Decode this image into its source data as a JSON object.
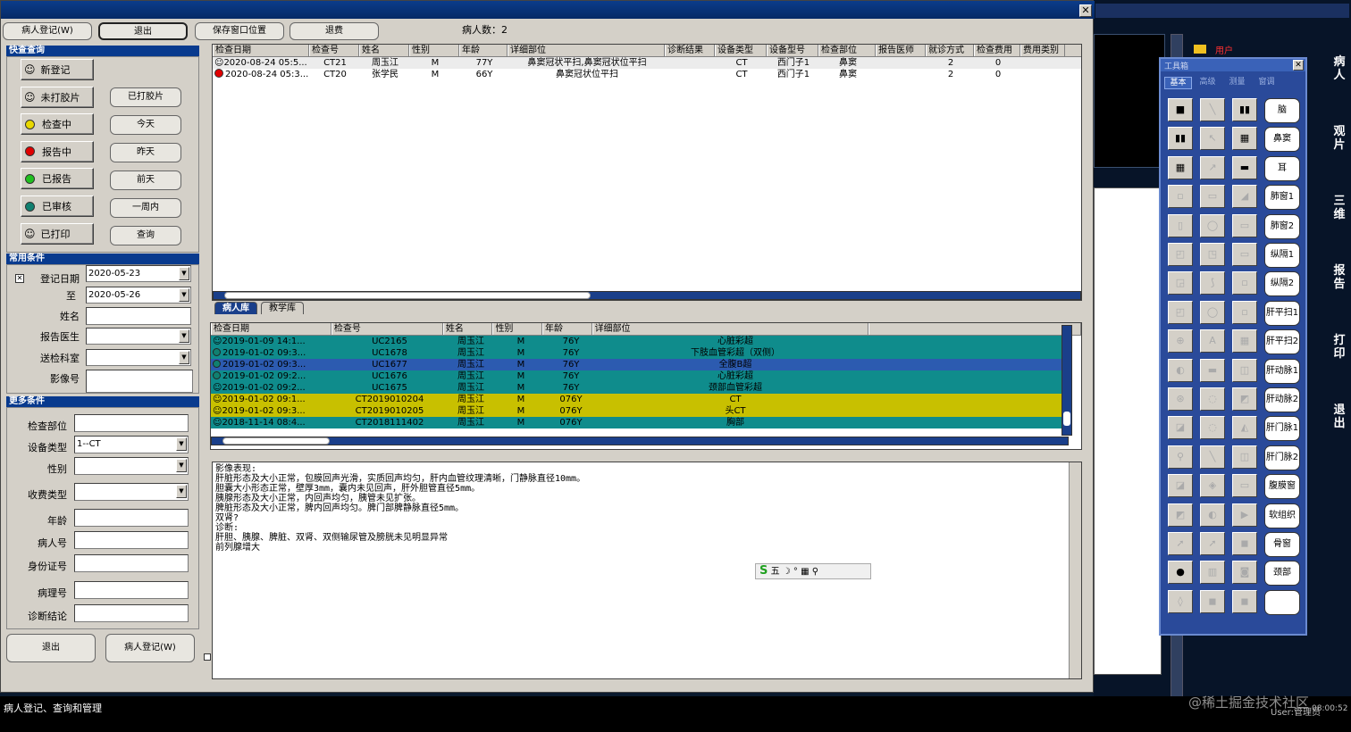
{
  "main": {
    "toolbar": {
      "register": "病人登记(W)",
      "exit": "退出",
      "save_position": "保存窗口位置",
      "refund": "退费",
      "patient_count": "病人数：2"
    }
  },
  "quick": {
    "header": "快查查询",
    "left": [
      {
        "label": "新登记",
        "icon": "smiley",
        "color": ""
      },
      {
        "label": "未打胶片",
        "icon": "smiley",
        "color": ""
      },
      {
        "label": "检查中",
        "icon": "dot",
        "color": "#e8d800"
      },
      {
        "label": "报告中",
        "icon": "dot",
        "color": "#e00000"
      },
      {
        "label": "已报告",
        "icon": "dot",
        "color": "#20c020"
      },
      {
        "label": "已审核",
        "icon": "dot",
        "color": "#108070"
      },
      {
        "label": "已打印",
        "icon": "smiley",
        "color": ""
      }
    ],
    "right": [
      "已打胶片",
      "今天",
      "昨天",
      "前天",
      "一周内",
      "查询"
    ]
  },
  "common": {
    "header": "常用条件",
    "reg_date_label": "登记日期",
    "date_from": "2020-05-23",
    "to_label": "至",
    "date_to": "2020-05-26",
    "name_label": "姓名",
    "doctor_label": "报告医生",
    "dept_label": "送检科室",
    "image_no_label": "影像号"
  },
  "more": {
    "header": "更多条件",
    "part_label": "检查部位",
    "device_label": "设备类型",
    "device_value": "1--CT",
    "sex_label": "性别",
    "fee_label": "收费类型",
    "age_label": "年龄",
    "patient_no_label": "病人号",
    "id_label": "身份证号",
    "pathology_label": "病理号",
    "diagnosis_label": "诊断结论"
  },
  "bottom": {
    "exit": "退出",
    "register": "病人登记(W)"
  },
  "exam_table": {
    "headers": [
      "检查日期",
      "检查号",
      "姓名",
      "性别",
      "年龄",
      "详细部位",
      "诊断结果",
      "设备类型",
      "设备型号",
      "检查部位",
      "报告医师",
      "就诊方式",
      "检查费用",
      "费用类别"
    ],
    "rows": [
      {
        "date": "2020-08-24 05:5...",
        "no": "CT21",
        "name": "周玉江",
        "sex": "M",
        "age": "77Y",
        "detail": "鼻窦冠状平扫,鼻窦冠状位平扫",
        "result": "",
        "device": "CT",
        "model": "西门子1",
        "part": "鼻窦",
        "doctor": "",
        "visit": "2",
        "fee": "0",
        "status": "smiley",
        "color": ""
      },
      {
        "date": "2020-08-24 05:3...",
        "no": "CT20",
        "name": "张学民",
        "sex": "M",
        "age": "66Y",
        "detail": "鼻窦冠状位平扫",
        "result": "",
        "device": "CT",
        "model": "西门子1",
        "part": "鼻窦",
        "doctor": "",
        "visit": "2",
        "fee": "0",
        "status": "dot",
        "color": "#e00000"
      }
    ]
  },
  "tabs": {
    "patient_lib": "病人库",
    "teaching_lib": "教学库"
  },
  "history_table": {
    "headers": [
      "检查日期",
      "检查号",
      "姓名",
      "性别",
      "年龄",
      "详细部位"
    ],
    "rows": [
      {
        "date": "2019-01-09 14:1...",
        "no": "UC2165",
        "name": "周玉江",
        "sex": "M",
        "age": "76Y",
        "detail": "心脏彩超",
        "bg": "#0f8c8c",
        "status": "smiley"
      },
      {
        "date": "2019-01-02 09:3...",
        "no": "UC1678",
        "name": "周玉江",
        "sex": "M",
        "age": "76Y",
        "detail": "下肢血管彩超（双侧）",
        "bg": "#0f8c8c",
        "status": "dot"
      },
      {
        "date": "2019-01-02 09:3...",
        "no": "UC1677",
        "name": "周玉江",
        "sex": "M",
        "age": "76Y",
        "detail": "全腹B超",
        "bg": "#2c5bb0",
        "status": "dot"
      },
      {
        "date": "2019-01-02 09:2...",
        "no": "UC1676",
        "name": "周玉江",
        "sex": "M",
        "age": "76Y",
        "detail": "心脏彩超",
        "bg": "#0f8c8c",
        "status": "dot"
      },
      {
        "date": "2019-01-02 09:2...",
        "no": "UC1675",
        "name": "周玉江",
        "sex": "M",
        "age": "76Y",
        "detail": "颈部血管彩超",
        "bg": "#0f8c8c",
        "status": "smiley"
      },
      {
        "date": "2019-01-02 09:1...",
        "no": "CT2019010204",
        "name": "周玉江",
        "sex": "M",
        "age": "076Y",
        "detail": "CT",
        "bg": "#c8c000",
        "status": "smiley"
      },
      {
        "date": "2019-01-02 09:3...",
        "no": "CT2019010205",
        "name": "周玉江",
        "sex": "M",
        "age": "076Y",
        "detail": "头CT",
        "bg": "#c8c000",
        "status": "smiley"
      },
      {
        "date": "2018-11-14 08:4...",
        "no": "CT2018111402",
        "name": "周玉江",
        "sex": "M",
        "age": "076Y",
        "detail": "胸部",
        "bg": "#0f8c8c",
        "status": "smiley"
      }
    ]
  },
  "report": {
    "lines": [
      "影像表现:",
      "肝脏形态及大小正常，包膜回声光滑，实质回声均匀，肝内血管纹理清晰，门静脉直径10mm。",
      "胆囊大小形态正常，壁厚3mm，囊内未见回声，肝外胆管直径5mm。",
      "胰腺形态及大小正常，内回声均匀，胰管未见扩张。",
      "脾脏形态及大小正常，脾内回声均匀。脾门部脾静脉直径5mm。",
      "双肾?",
      "诊断:",
      "肝胆、胰腺、脾脏、双肾、双侧输尿管及膀胱未见明显异常",
      "前列腺增大"
    ],
    "ime_char": "五"
  },
  "status_bar": {
    "text": "病人登记、查询和管理",
    "user": "User:管理员",
    "time": "08:00:52"
  },
  "watermark": "@稀土掘金技术社区",
  "toolbox": {
    "title": "工具箱",
    "tabs": [
      "基本",
      "高级",
      "测量",
      "窗调"
    ],
    "presets": [
      "脑",
      "鼻窦",
      "耳",
      "肺窗1",
      "肺窗2",
      "纵隔1",
      "纵隔2",
      "肝平扫1",
      "肝平扫2",
      "肝动脉1",
      "肝动脉2",
      "肝门脉1",
      "肝门脉2",
      "腹膜窗",
      "软组织",
      "骨窗",
      "颈部",
      ""
    ]
  },
  "side_menu": [
    "病人",
    "观片",
    "三维",
    "报告",
    "打印",
    "退出"
  ],
  "bg_window": {
    "label": "用户"
  }
}
